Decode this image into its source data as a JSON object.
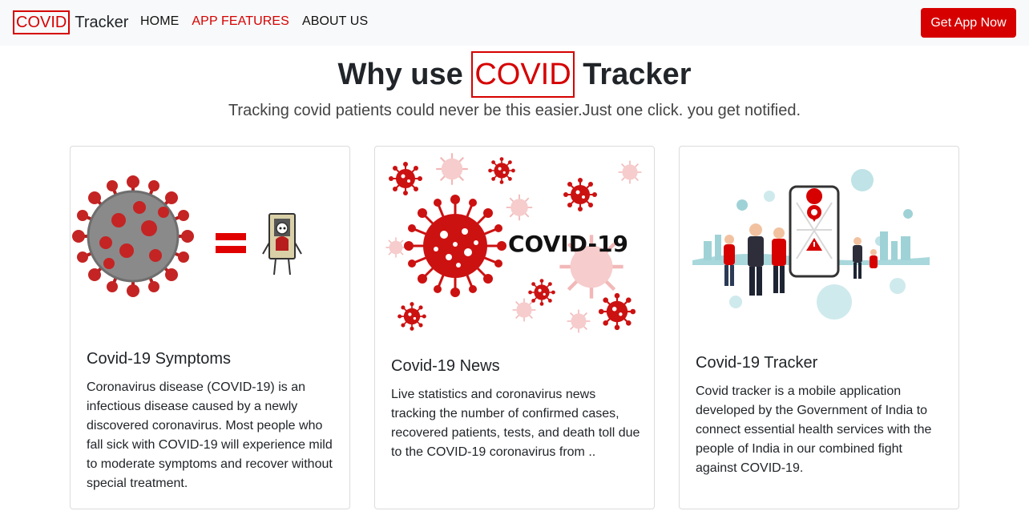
{
  "navbar": {
    "brand_box": "COVID",
    "brand_text": "Tracker",
    "links": [
      {
        "label": "HOME",
        "active": false
      },
      {
        "label": "APP FEATURES",
        "active": true
      },
      {
        "label": "ABOUT US",
        "active": false
      }
    ],
    "cta_label": "Get App Now"
  },
  "hero": {
    "title_before": "Why use",
    "title_boxed": "COVID",
    "title_after": "Tracker",
    "subtitle": "Tracking covid patients could never be this easier.Just one click. you get notified."
  },
  "cards": [
    {
      "image_icon": "virus-equals-sick-person-illustration",
      "title": "Covid-19 Symptoms",
      "text": "Coronavirus disease (COVID-19) is an infectious disease caused by a newly discovered coronavirus. Most people who fall sick with COVID-19 will experience mild to moderate symptoms and recover without special treatment."
    },
    {
      "image_icon": "covid-19-virus-banner",
      "image_caption": "COVID-19",
      "title": "Covid-19 News",
      "text": "Live statistics and coronavirus news tracking the number of confirmed cases, recovered patients, tests, and death toll due to the COVID-19 coronavirus from .."
    },
    {
      "image_icon": "people-with-phone-tracker-illustration",
      "title": "Covid-19 Tracker",
      "text": "Covid tracker is a mobile application developed by the Government of India to connect essential health services with the people of India in our combined fight against COVID-19."
    }
  ],
  "colors": {
    "accent": "#d60000",
    "navbar_bg": "#f8f9fa",
    "text": "#212529"
  }
}
